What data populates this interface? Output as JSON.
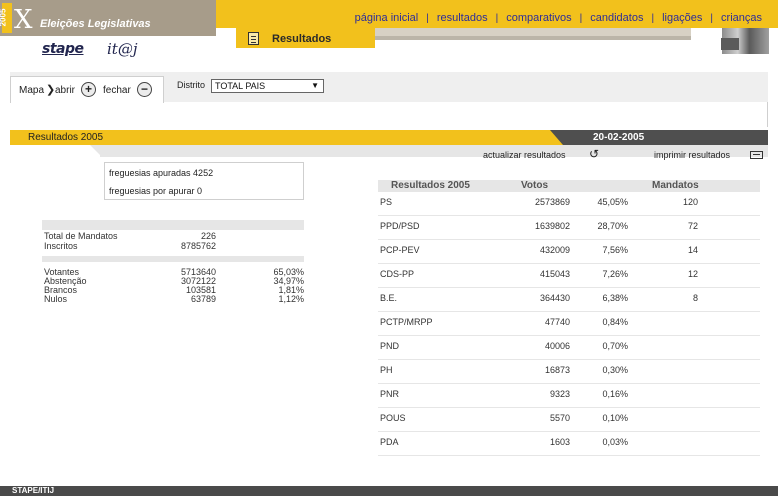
{
  "header": {
    "year": "2005",
    "site_title": "Eleições Legislativas",
    "nav": [
      "página inicial",
      "resultados",
      "comparativos",
      "candidatos",
      "ligações",
      "crianças"
    ],
    "logo_stape": "stape",
    "logo_itij": "it@j",
    "section_tab": "Resultados"
  },
  "controls": {
    "mapa_label": "Mapa",
    "abrir_label": "abrir",
    "fechar_label": "fechar",
    "plus_icon": "+",
    "minus_icon": "−",
    "distrito_label": "Distrito",
    "distrito_value": "TOTAL PAIS"
  },
  "results_bar": {
    "title": "Resultados  2005",
    "date": "20-02-2005",
    "actualizar": "actualizar resultados",
    "imprimir": "imprimir resultados"
  },
  "freguesias": {
    "apuradas": "freguesias apuradas 4252",
    "por_apurar": "freguesias por apurar 0"
  },
  "stats": {
    "total_mandatos_label": "Total de Mandatos",
    "total_mandatos_value": "226",
    "inscritos_label": "Inscritos",
    "inscritos_value": "8785762",
    "rows": [
      {
        "label": "Votantes",
        "value": "5713640",
        "pct": "65,03%"
      },
      {
        "label": "Abstenção",
        "value": "3072122",
        "pct": "34,97%"
      },
      {
        "label": "Brancos",
        "value": "103581",
        "pct": "1,81%"
      },
      {
        "label": "Nulos",
        "value": "63789",
        "pct": "1,12%"
      }
    ]
  },
  "table": {
    "headers": {
      "party": "Resultados 2005",
      "votes": "Votos",
      "mandates": "Mandatos"
    },
    "rows": [
      {
        "party": "PS",
        "votes": "2573869",
        "pct": "45,05%",
        "mandates": "120"
      },
      {
        "party": "PPD/PSD",
        "votes": "1639802",
        "pct": "28,70%",
        "mandates": "72"
      },
      {
        "party": "PCP-PEV",
        "votes": "432009",
        "pct": "7,56%",
        "mandates": "14"
      },
      {
        "party": "CDS-PP",
        "votes": "415043",
        "pct": "7,26%",
        "mandates": "12"
      },
      {
        "party": "B.E.",
        "votes": "364430",
        "pct": "6,38%",
        "mandates": "8"
      },
      {
        "party": "PCTP/MRPP",
        "votes": "47740",
        "pct": "0,84%",
        "mandates": ""
      },
      {
        "party": "PND",
        "votes": "40006",
        "pct": "0,70%",
        "mandates": ""
      },
      {
        "party": "PH",
        "votes": "16873",
        "pct": "0,30%",
        "mandates": ""
      },
      {
        "party": "PNR",
        "votes": "9323",
        "pct": "0,16%",
        "mandates": ""
      },
      {
        "party": "POUS",
        "votes": "5570",
        "pct": "0,10%",
        "mandates": ""
      },
      {
        "party": "PDA",
        "votes": "1603",
        "pct": "0,03%",
        "mandates": ""
      }
    ]
  },
  "footer": {
    "text": "STAPE/ITIJ"
  },
  "colors": {
    "accent_yellow": "#f2c11c",
    "header_gray": "#a79c8a",
    "dark_bar": "#4f4f4f",
    "link_blue": "#2d2d99"
  }
}
